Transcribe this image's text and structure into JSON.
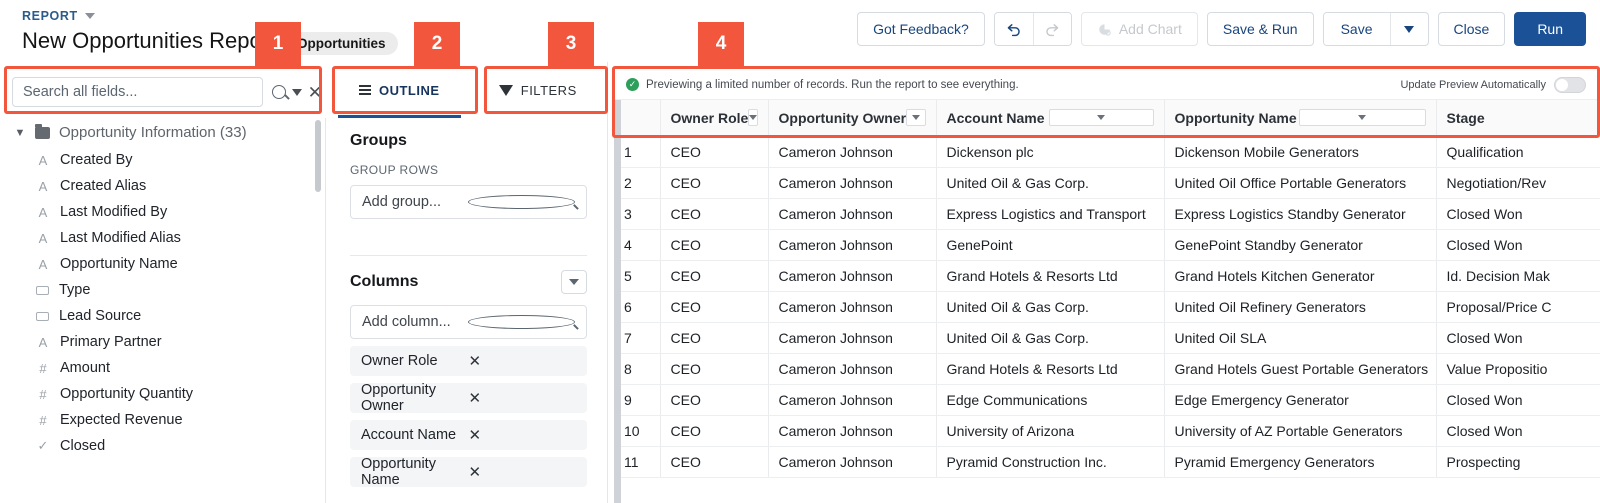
{
  "header": {
    "report_label": "REPORT",
    "title": "New Opportunities Report",
    "subject": "Opportunities"
  },
  "toolbar": {
    "feedback": "Got Feedback?",
    "undo_icon": "undo-icon",
    "redo_icon": "redo-icon",
    "add_chart": "Add Chart",
    "add_chart_icon": "chart-icon",
    "save_and_run": "Save & Run",
    "save": "Save",
    "save_menu_icon": "chevron-down-icon",
    "close": "Close",
    "run": "Run",
    "primary_color": "#1b5297"
  },
  "search": {
    "placeholder": "Search all fields...",
    "value": "",
    "search_icon": "search-icon",
    "dropdown_icon": "chevron-down-icon",
    "clear_icon": "close-icon"
  },
  "fields": {
    "group_name": "Opportunity Information (33)",
    "expand_icon": "chevron-down-icon",
    "folder_icon": "folder-icon",
    "items": [
      {
        "label": "Created By",
        "type": "A"
      },
      {
        "label": "Created Alias",
        "type": "A"
      },
      {
        "label": "Last Modified By",
        "type": "A"
      },
      {
        "label": "Last Modified Alias",
        "type": "A"
      },
      {
        "label": "Opportunity Name",
        "type": "A"
      },
      {
        "label": "Type",
        "type": "box"
      },
      {
        "label": "Lead Source",
        "type": "box"
      },
      {
        "label": "Primary Partner",
        "type": "A"
      },
      {
        "label": "Amount",
        "type": "#"
      },
      {
        "label": "Opportunity Quantity",
        "type": "#"
      },
      {
        "label": "Expected Revenue",
        "type": "#"
      },
      {
        "label": "Closed",
        "type": "✓"
      }
    ]
  },
  "panel": {
    "tabs": [
      {
        "label": "OUTLINE",
        "icon": "list-icon",
        "active": true
      },
      {
        "label": "FILTERS",
        "icon": "funnel-icon",
        "active": false
      }
    ],
    "groups": {
      "title": "Groups",
      "sub_label": "GROUP ROWS",
      "add_placeholder": "Add group...",
      "search_icon": "search-icon"
    },
    "columns": {
      "title": "Columns",
      "menu_icon": "chevron-down-icon",
      "add_placeholder": "Add column...",
      "search_icon": "search-icon",
      "items": [
        {
          "label": "Owner Role",
          "remove_icon": "close-icon"
        },
        {
          "label": "Opportunity Owner",
          "remove_icon": "close-icon"
        },
        {
          "label": "Account Name",
          "remove_icon": "close-icon"
        },
        {
          "label": "Opportunity Name",
          "remove_icon": "close-icon"
        }
      ]
    }
  },
  "preview": {
    "banner_text": "Previewing a limited number of records. Run the report to see everything.",
    "banner_icon": "success-check-icon",
    "toggle_label": "Update Preview Automatically",
    "toggle_on": false,
    "columns": [
      {
        "label": "",
        "menu": false
      },
      {
        "label": "Owner Role",
        "menu": true
      },
      {
        "label": "Opportunity Owner",
        "menu": true
      },
      {
        "label": "Account Name",
        "menu": true
      },
      {
        "label": "Opportunity Name",
        "menu": true
      },
      {
        "label": "Stage",
        "menu": false
      }
    ],
    "rows": [
      {
        "n": "1",
        "owner_role": "CEO",
        "owner": "Cameron Johnson",
        "account": "Dickenson plc",
        "opportunity": "Dickenson Mobile Generators",
        "stage": "Qualification"
      },
      {
        "n": "2",
        "owner_role": "CEO",
        "owner": "Cameron Johnson",
        "account": "United Oil & Gas Corp.",
        "opportunity": "United Oil Office Portable Generators",
        "stage": "Negotiation/Rev"
      },
      {
        "n": "3",
        "owner_role": "CEO",
        "owner": "Cameron Johnson",
        "account": "Express Logistics and Transport",
        "opportunity": "Express Logistics Standby Generator",
        "stage": "Closed Won"
      },
      {
        "n": "4",
        "owner_role": "CEO",
        "owner": "Cameron Johnson",
        "account": "GenePoint",
        "opportunity": "GenePoint Standby Generator",
        "stage": "Closed Won"
      },
      {
        "n": "5",
        "owner_role": "CEO",
        "owner": "Cameron Johnson",
        "account": "Grand Hotels & Resorts Ltd",
        "opportunity": "Grand Hotels Kitchen Generator",
        "stage": "Id. Decision Mak"
      },
      {
        "n": "6",
        "owner_role": "CEO",
        "owner": "Cameron Johnson",
        "account": "United Oil & Gas Corp.",
        "opportunity": "United Oil Refinery Generators",
        "stage": "Proposal/Price C"
      },
      {
        "n": "7",
        "owner_role": "CEO",
        "owner": "Cameron Johnson",
        "account": "United Oil & Gas Corp.",
        "opportunity": "United Oil SLA",
        "stage": "Closed Won"
      },
      {
        "n": "8",
        "owner_role": "CEO",
        "owner": "Cameron Johnson",
        "account": "Grand Hotels & Resorts Ltd",
        "opportunity": "Grand Hotels Guest Portable Generators",
        "stage": "Value Propositio"
      },
      {
        "n": "9",
        "owner_role": "CEO",
        "owner": "Cameron Johnson",
        "account": "Edge Communications",
        "opportunity": "Edge Emergency Generator",
        "stage": "Closed Won"
      },
      {
        "n": "10",
        "owner_role": "CEO",
        "owner": "Cameron Johnson",
        "account": "University of Arizona",
        "opportunity": "University of AZ Portable Generators",
        "stage": "Closed Won"
      },
      {
        "n": "11",
        "owner_role": "CEO",
        "owner": "Cameron Johnson",
        "account": "Pyramid Construction Inc.",
        "opportunity": "Pyramid Emergency Generators",
        "stage": "Prospecting"
      }
    ]
  },
  "callouts": [
    {
      "number": "1"
    },
    {
      "number": "2"
    },
    {
      "number": "3"
    },
    {
      "number": "4"
    }
  ],
  "accent_color": "#f2563c"
}
